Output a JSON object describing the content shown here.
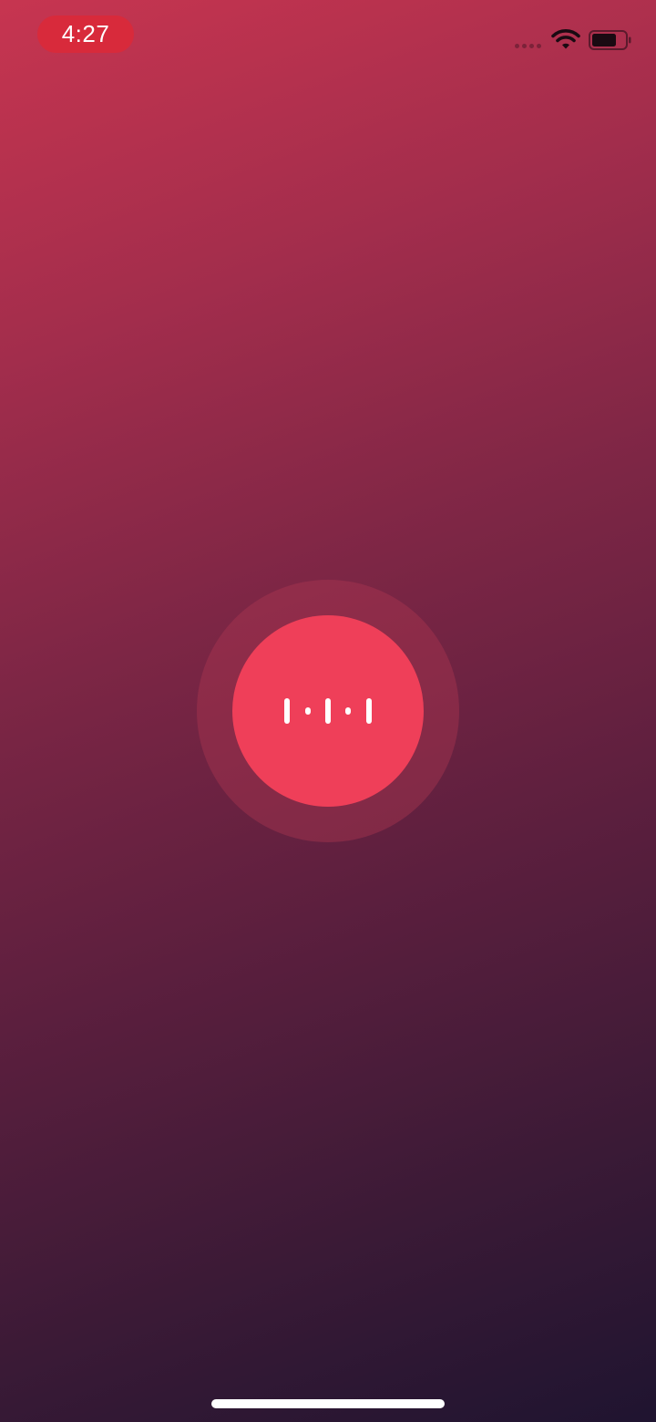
{
  "status_bar": {
    "time": "4:27",
    "time_pill_color": "#d82a3b",
    "signal_icon": "cellular-signal-searching-icon",
    "wifi_icon": "wifi-icon",
    "battery_icon": "battery-icon"
  },
  "main": {
    "record_button_icon": "waveform-icon",
    "record_button_color": "#ef3f59",
    "ring_color": "#af3750"
  },
  "background": {
    "gradient_top": "#c73550",
    "gradient_bottom": "#1f1430"
  }
}
